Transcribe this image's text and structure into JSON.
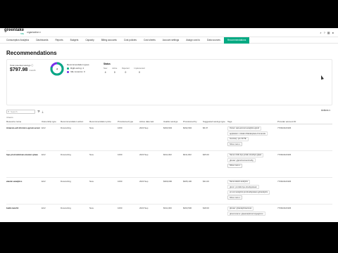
{
  "app": {
    "logo": "greenlake",
    "logo_sub": "HPE",
    "org": "organization ▾"
  },
  "tabs": [
    "Consumption Analytics",
    "Dashboards",
    "Reports",
    "Budgets",
    "Capacity",
    "Billing accounts",
    "Cost policies",
    "Cost sheets",
    "Account settings",
    "Assign cost to",
    "Data sources",
    "Recommendations"
  ],
  "active_tab": "Recommendations",
  "page": {
    "title": "Recommendations"
  },
  "summary": {
    "savings_label": "Total potential savings ⓘ",
    "savings_value": "$797.98",
    "savings_unit": "/month",
    "donut_center": "4",
    "legend_title": "Recommendation types",
    "legend_items": [
      {
        "label": "Right-sizing: 4",
        "color": "#01a982"
      },
      {
        "label": "Idle resource: 0",
        "color": "#7630ea"
      }
    ],
    "status_title": "Status",
    "status": [
      {
        "label": "New",
        "value": "4"
      },
      {
        "label": "Active",
        "value": "0"
      },
      {
        "label": "Rejected",
        "value": "0"
      },
      {
        "label": "Implemented",
        "value": "0"
      }
    ]
  },
  "toolbar": {
    "search_placeholder": "Search",
    "filter_icon": "filter-icon",
    "download_icon": "download-icon",
    "actions_label": "Actions ▾",
    "count": "4 items"
  },
  "table": {
    "headers": [
      "Resource name",
      "Ownership type",
      "Recommendation action",
      "Recommendation price",
      "Provisioned type",
      "Active date last",
      "Usable savings",
      "Provisioned by",
      "Suggested savings type",
      "Tags",
      "Provider account ID"
    ],
    "rows": [
      {
        "name": "Amazon-ec2-t2.micro-qprod-server",
        "ownership": "EC2",
        "action": "Downsizing",
        "price": "New",
        "ptype": "1060",
        "date": "2023 Sep",
        "usable": "$293,994",
        "prov": "$292,994",
        "sugg": "$6.07",
        "tags": [
          "Owner: aws-account-analytics-qprod",
          "application: mfulab-CMarketplace-Frontends",
          "Inventory: pro-SCTE"
        ],
        "more": "Show more ▾",
        "acct": "770623421906"
      },
      {
        "name": "hpe-prod-windows-master-qmaa",
        "ownership": "EC2",
        "action": "Downsizing",
        "price": "New",
        "ptype": "1060",
        "date": "2023 Sep",
        "usable": "$311,002",
        "prov": "$311,002",
        "sugg": "$25.00",
        "tags": [
          "Name:mfolk-hpe-pmlab-cloudops-glaas",
          "glcuser: gljenvironmentconfig"
        ],
        "more": "Show more ▾",
        "acct": "770623421906"
      },
      {
        "name": "elastic-analytics",
        "ownership": "EC2",
        "action": "Downsizing",
        "price": "New",
        "ptype": "1060",
        "date": "2023 Sep",
        "usable": "$309,090",
        "prov": "$305,100",
        "sugg": "$31.00",
        "tags": [
          "Name:elastic-analytics",
          "glcom: pmclab-hpe-cloudopsteam",
          "pm:env:analytics:pmcloudopsteam-glcanalytics"
        ],
        "more": "Show more ▾",
        "acct": "770623421906"
      },
      {
        "name": "build-ranch1",
        "ownership": "EC2",
        "action": "Downsizing",
        "price": "New",
        "ptype": "1060",
        "date": "2023 Sep",
        "usable": "$311,000",
        "prov": "$263,500",
        "sugg": "$18.00",
        "tags": [
          "glcuser: glcanalyticsaccess",
          "glcsenvname: glpaanalyticsenvtypeglcmn"
        ],
        "more": "",
        "acct": "770623421906"
      }
    ]
  }
}
